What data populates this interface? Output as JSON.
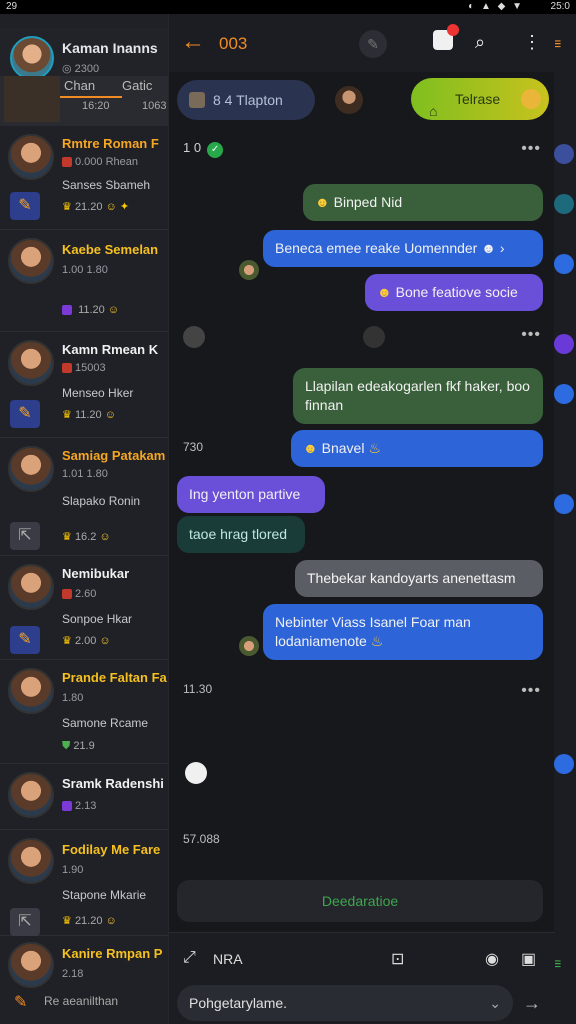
{
  "status_bar": {
    "left": "29",
    "time": "25:0",
    "icons": "◐ ▲ ◆ ▼"
  },
  "left_header": {
    "name": "Kaman Inanns",
    "sub": "2300"
  },
  "left_header_tab": {
    "a": "Chan",
    "b": "Gatic",
    "t1": "16:20",
    "t2": "1063"
  },
  "chats": [
    {
      "name": "Rmtre Roman F",
      "sub": "0.000 Rhean",
      "preview": "Sanses Sbameh",
      "time": "21.20",
      "accent": "#f5a623"
    },
    {
      "name": "Kaebe Semelan",
      "sub": "1.00 1.80",
      "preview": "",
      "time": "11.20",
      "accent": "#f0c020"
    },
    {
      "name": "Kamn Rmean K",
      "sub": "15003",
      "preview": "Menseo Hker",
      "time": "11.20",
      "accent": "#ffffff"
    },
    {
      "name": "Samiag Patakam",
      "sub": "1.01 1.80",
      "preview": "Slapako Ronin",
      "time": "16.2",
      "accent": "#f5a623"
    },
    {
      "name": "Nemibukar",
      "sub": "2.60",
      "preview": "Sonpoe Hkar",
      "time": "2.00",
      "accent": "#ffffff"
    },
    {
      "name": "Prande Faltan Fa",
      "sub": "1.80",
      "preview": "Samone Rcame",
      "time": "21.9",
      "accent": "#f5c020"
    },
    {
      "name": "Sramk Radenshi",
      "sub": "2.13",
      "preview": "",
      "time": "",
      "accent": "#ffffff"
    },
    {
      "name": "Fodilay Me Fare",
      "sub": "1.90",
      "preview": "Stapone Mkarie",
      "time": "21.20",
      "accent": "#f5c020"
    },
    {
      "name": "Kanire Rmpan P",
      "sub": "2.18",
      "preview": "Re aeanilthan",
      "time": "",
      "accent": "#f5c020"
    }
  ],
  "header": {
    "title": "003",
    "back_icon": "arrow-left-icon"
  },
  "chips": {
    "left": "8 4 Tlapton",
    "right": "Telrase"
  },
  "messages": {
    "date1": "1 0",
    "b1": "Binped Nid",
    "b2": "Beneca emee reake Uomennder",
    "b3": "Bone featiove socie",
    "b4": "Llapilan edeakogarlen fkf haker, boo finnan",
    "b5": "Bnavel",
    "b6": "Ing yenton partive",
    "b7": "taoe hrag tlored",
    "b8": "Thebekar kandoyarts anenettasm",
    "b9": "Nebinter Viass Isanel Foar man lodaniamenote",
    "time_a": "730",
    "time_b": "11.30",
    "time_c": "57.088"
  },
  "big_button": "Deedaratioe",
  "composer": {
    "label": "NRA",
    "placeholder": "Pohgetarylame."
  }
}
